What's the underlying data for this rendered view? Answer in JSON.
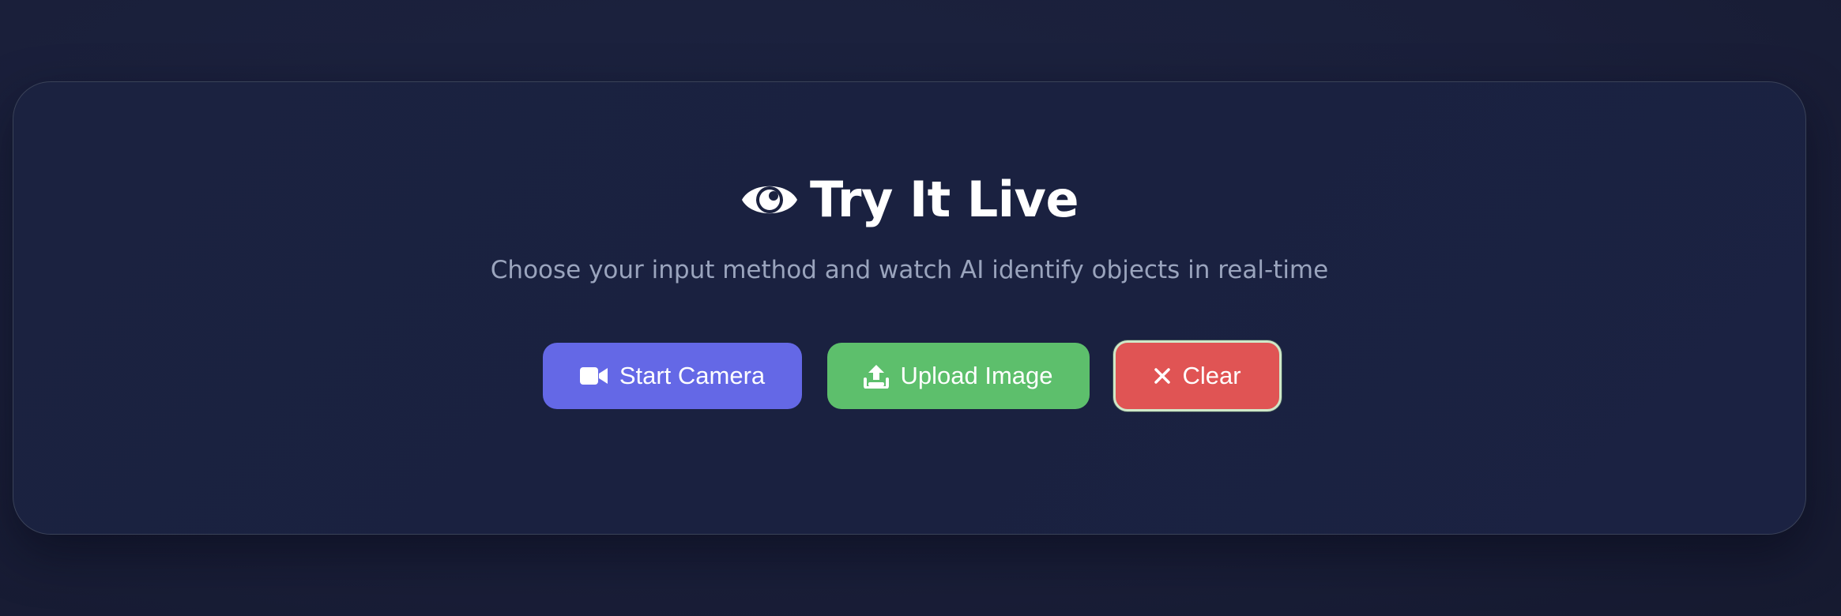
{
  "section": {
    "title": "Try It Live",
    "title_icon": "eye-icon",
    "subtitle": "Choose your input method and watch AI identify objects in real-time"
  },
  "buttons": {
    "camera": {
      "label": "Start Camera",
      "icon": "video-camera-icon",
      "color": "#6468e6"
    },
    "upload": {
      "label": "Upload Image",
      "icon": "upload-icon",
      "color": "#5dbf6c"
    },
    "clear": {
      "label": "Clear",
      "icon": "close-icon",
      "color": "#e05454"
    }
  },
  "colors": {
    "background": "#1a1f3a",
    "card_border": "#3a4258",
    "title": "#ffffff",
    "subtitle": "#9aa4bd"
  }
}
